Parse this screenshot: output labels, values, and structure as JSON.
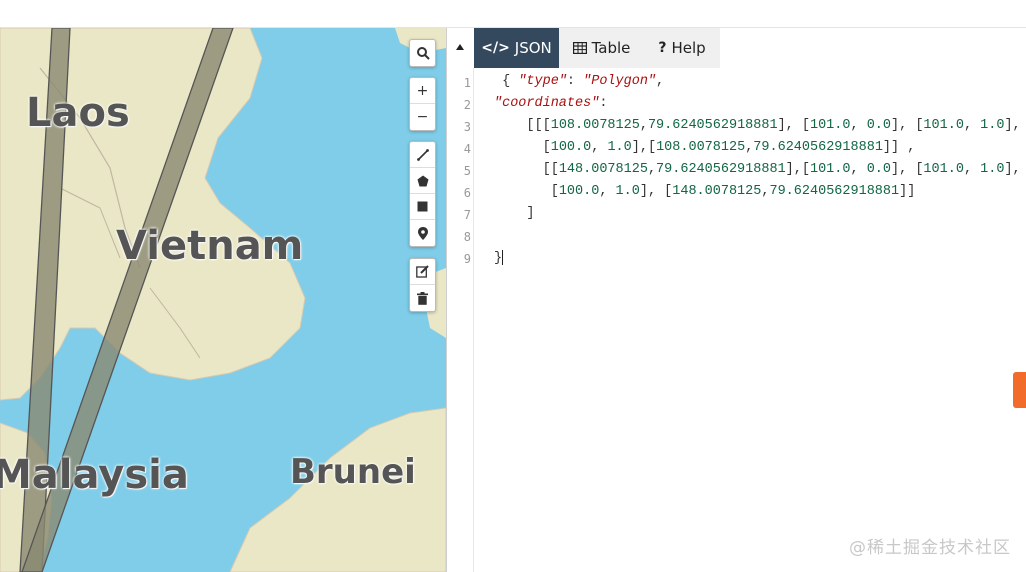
{
  "map": {
    "labels": {
      "laos": "Laos",
      "vietnam": "Vietnam",
      "malaysia": "Malaysia",
      "brunei": "Brunei"
    },
    "controls": {
      "search": "search-icon",
      "zoom_in": "+",
      "zoom_out": "−",
      "draw_tools": [
        "line-icon",
        "polygon-icon",
        "rectangle-icon",
        "marker-icon"
      ],
      "edit_tools": [
        "edit-icon",
        "trash-icon"
      ]
    }
  },
  "editor": {
    "tabs": [
      {
        "label": "JSON",
        "icon": "</>",
        "active": true
      },
      {
        "label": "Table",
        "icon": "table-icon",
        "active": false
      },
      {
        "label": "Help",
        "icon": "?",
        "active": false
      }
    ],
    "line_numbers": [
      "1",
      "2",
      "3",
      "4",
      "5",
      "6",
      "7",
      "8",
      "9"
    ],
    "lines": [
      " { \"type\": \"Polygon\",",
      "\"coordinates\":",
      "    [[[108.0078125,79.6240562918881], [101.0, 0.0], [101.0, 1.0],",
      "      [100.0, 1.0],[108.0078125,79.6240562918881]] ,",
      "      [[148.0078125,79.6240562918881],[101.0, 0.0], [101.0, 1.0],",
      "       [100.0, 1.0], [148.0078125,79.6240562918881]]",
      "    ]",
      "",
      "}"
    ]
  },
  "watermark": "@稀土掘金技术社区",
  "colors": {
    "tab_active_bg": "#34495e",
    "ocean": "#7fcde9",
    "land": "#eae7c6",
    "polygon_fill": "#8a8a72",
    "brand_orange": "#f26b2a"
  }
}
